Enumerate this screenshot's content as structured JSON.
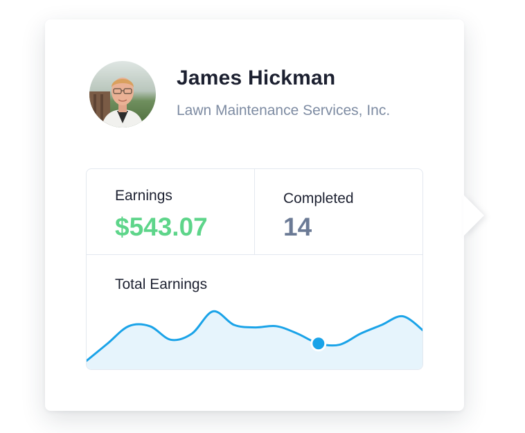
{
  "profile": {
    "name": "James Hickman",
    "company": "Lawn Maintenance Services, Inc."
  },
  "stats": {
    "earnings_label": "Earnings",
    "earnings_value": "$543.07",
    "completed_label": "Completed",
    "completed_value": "14"
  },
  "chart": {
    "title": "Total Earnings"
  },
  "chart_data": {
    "type": "area",
    "title": "Total Earnings",
    "xlabel": "",
    "ylabel": "",
    "x": [
      0,
      1,
      2,
      3,
      4,
      5,
      6,
      7,
      8,
      9,
      10,
      11,
      12,
      13,
      14,
      15,
      16
    ],
    "values": [
      8,
      22,
      36,
      36,
      25,
      30,
      48,
      37,
      35,
      36,
      30,
      22,
      21,
      30,
      37,
      44,
      32
    ],
    "highlighted_index": 11,
    "grid": false,
    "ylim": [
      0,
      60
    ],
    "line_color": "#1aa3e8",
    "fill_color": "#e6f4fc",
    "marker_color": "#1aa3e8"
  },
  "colors": {
    "earnings_value": "#5ed58a",
    "completed_value": "#6b7a95",
    "name": "#1c2030",
    "company": "#7d8ba2",
    "border": "#e3e8ef"
  },
  "icons": {
    "avatar": "user-photo"
  }
}
